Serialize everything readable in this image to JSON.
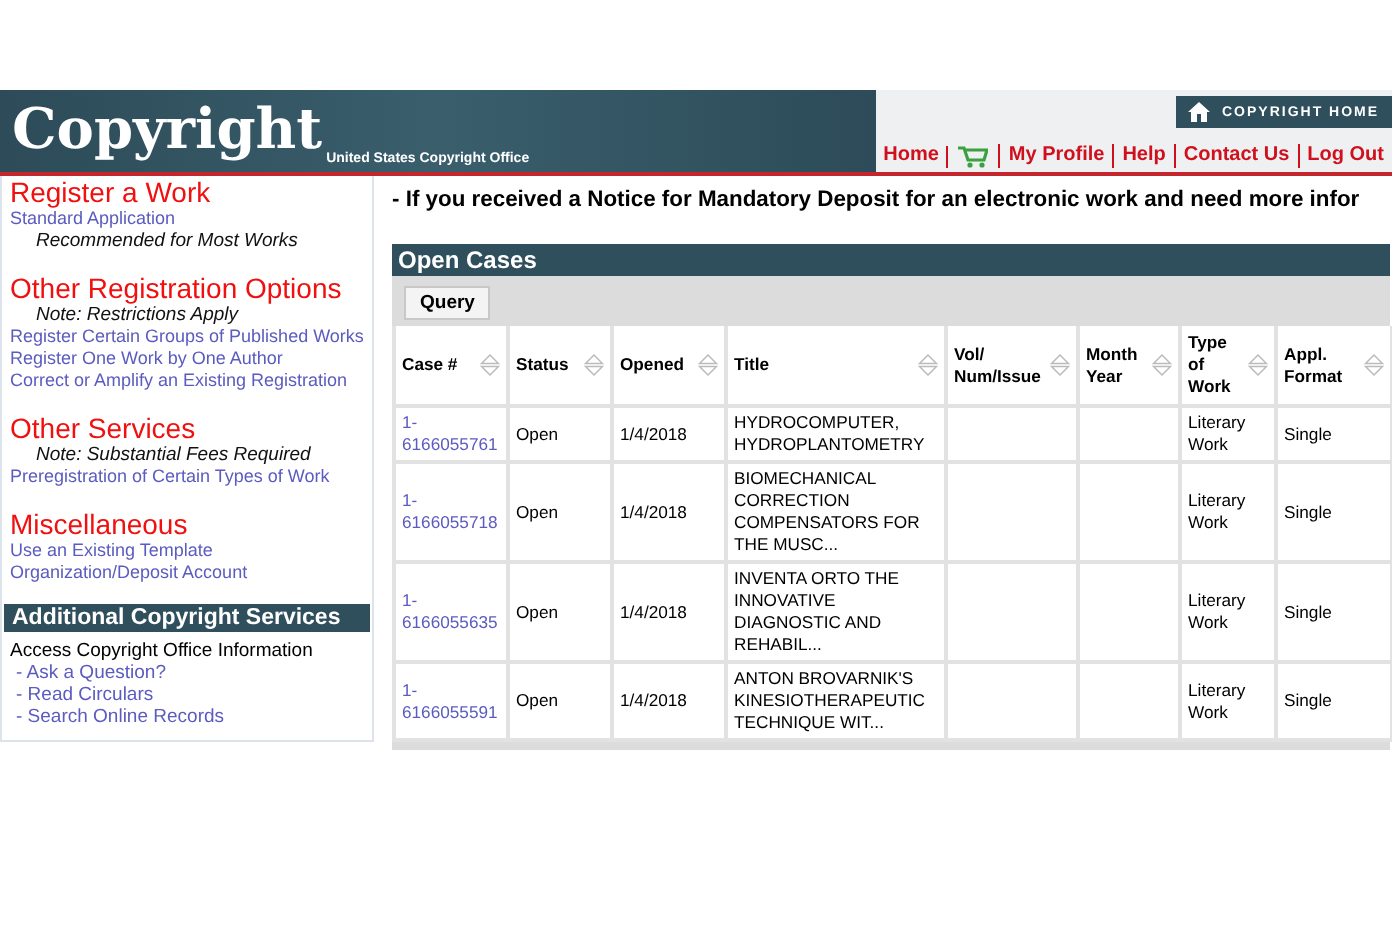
{
  "header": {
    "logo": "Copyright",
    "subtitle": "United States Copyright Office",
    "home_button": "COPYRIGHT HOME",
    "nav": [
      {
        "label": "Home",
        "kind": "text"
      },
      {
        "kind": "cart"
      },
      {
        "label": "My Profile",
        "kind": "text"
      },
      {
        "label": "Help",
        "kind": "text"
      },
      {
        "label": "Contact Us",
        "kind": "text"
      },
      {
        "label": "Log Out",
        "kind": "text"
      }
    ]
  },
  "sidebar": {
    "sections": [
      {
        "heading": "Register a Work",
        "items": [
          {
            "kind": "link",
            "text": "Standard Application"
          },
          {
            "kind": "note",
            "text": "Recommended for Most Works"
          }
        ]
      },
      {
        "heading": "Other Registration Options",
        "items": [
          {
            "kind": "note",
            "text": "Note: Restrictions Apply"
          },
          {
            "kind": "link",
            "text": "Register Certain Groups of Published Works"
          },
          {
            "kind": "link",
            "text": "Register One Work by One Author"
          },
          {
            "kind": "link",
            "text": "Correct or Amplify an Existing Registration"
          }
        ]
      },
      {
        "heading": "Other Services",
        "items": [
          {
            "kind": "note",
            "text": "Note: Substantial Fees Required"
          },
          {
            "kind": "link",
            "text": "Preregistration of Certain Types of Work"
          }
        ]
      },
      {
        "heading": "Miscellaneous",
        "items": [
          {
            "kind": "link",
            "text": "Use an Existing Template"
          },
          {
            "kind": "link",
            "text": "Organization/Deposit Account"
          }
        ]
      }
    ],
    "additional": {
      "title": "Additional Copyright Services",
      "intro": "Access Copyright Office Information",
      "links": [
        "- Ask a Question?",
        "- Read Circulars",
        "- Search Online Records"
      ]
    }
  },
  "notice": "- If you received a Notice for Mandatory Deposit for an electronic work and need more infor",
  "open_cases": {
    "title": "Open Cases",
    "query_button": "Query",
    "columns": [
      "Case #",
      "Status",
      "Opened",
      "Title",
      "Vol/ Num/Issue",
      "Month Year",
      "Type of Work",
      "Appl. Format"
    ],
    "rows": [
      {
        "case": "1- 6166055761",
        "status": "Open",
        "opened": "1/4/2018",
        "title": "HYDROCOMPUTER, HYDROPLANTOMETRY",
        "type": "Literary Work",
        "format": "Single"
      },
      {
        "case": "1- 6166055718",
        "status": "Open",
        "opened": "1/4/2018",
        "title": "BIOMECHANICAL CORRECTION COMPENSATORS FOR THE MUSC...",
        "type": "Literary Work",
        "format": "Single"
      },
      {
        "case": "1- 6166055635",
        "status": "Open",
        "opened": "1/4/2018",
        "title": "INVENTA ORTO THE INNOVATIVE DIAGNOSTIC AND REHABIL...",
        "type": "Literary Work",
        "format": "Single"
      },
      {
        "case": "1- 6166055591",
        "status": "Open",
        "opened": "1/4/2018",
        "title": "ANTON BROVARNIK'S KINESIOTHERAPEUTIC TECHNIQUE WIT...",
        "type": "Literary Work",
        "format": "Single"
      }
    ]
  }
}
